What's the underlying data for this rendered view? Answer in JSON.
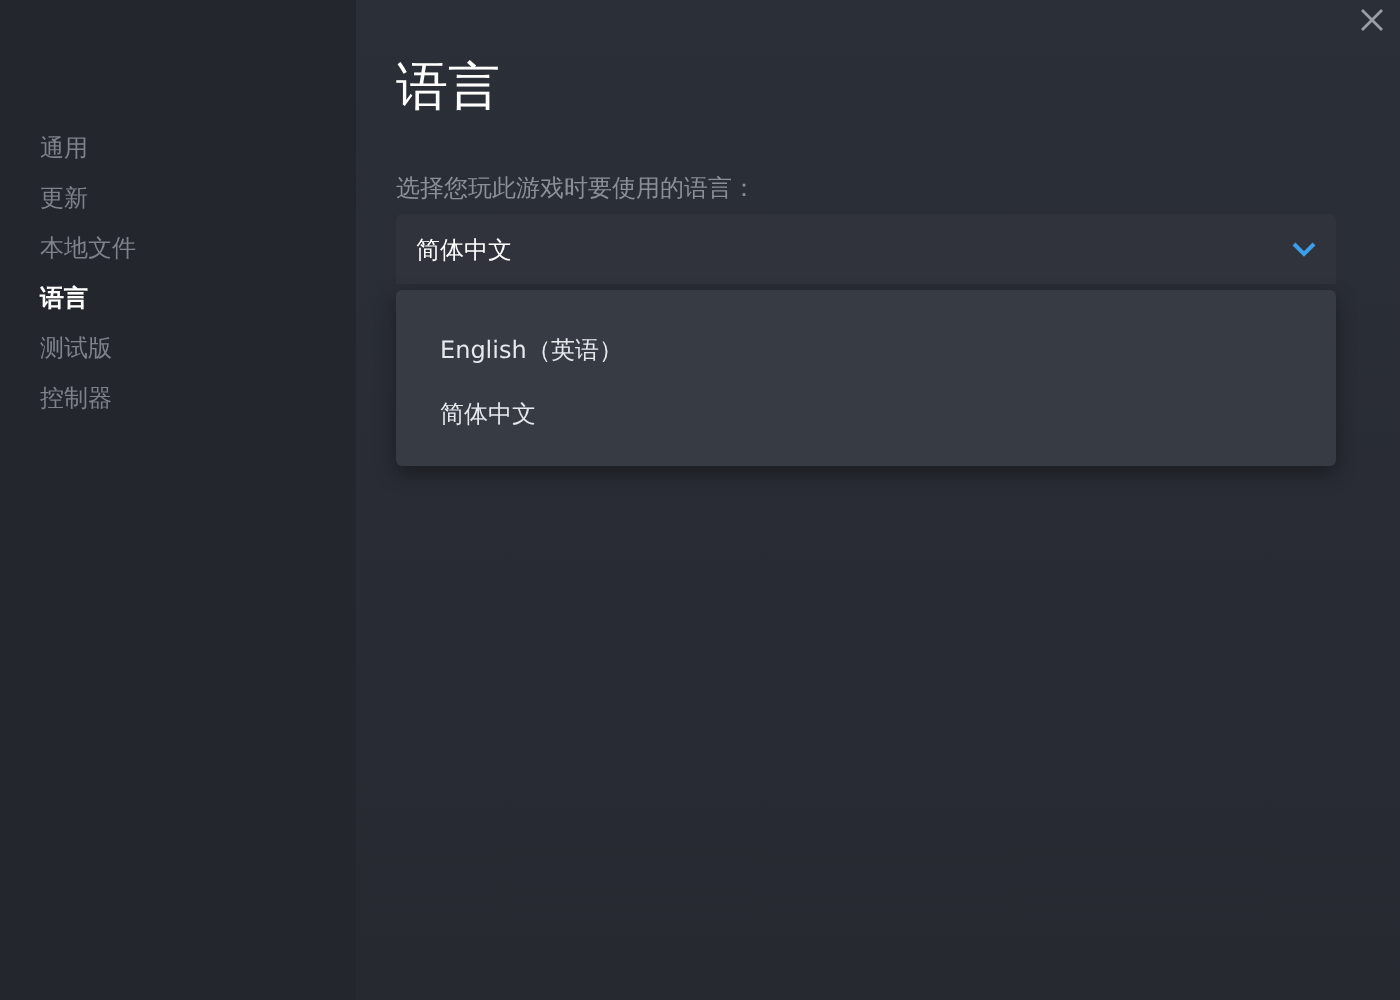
{
  "sidebar": {
    "items": [
      {
        "label": "通用",
        "selected": false
      },
      {
        "label": "更新",
        "selected": false
      },
      {
        "label": "本地文件",
        "selected": false
      },
      {
        "label": "语言",
        "selected": true
      },
      {
        "label": "测试版",
        "selected": false
      },
      {
        "label": "控制器",
        "selected": false
      }
    ]
  },
  "page": {
    "title": "语言",
    "field_label": "选择您玩此游戏时要使用的语言：",
    "dropdown": {
      "value": "简体中文",
      "expanded": true,
      "options": [
        {
          "label": "English（英语）"
        },
        {
          "label": "简体中文"
        }
      ]
    }
  }
}
